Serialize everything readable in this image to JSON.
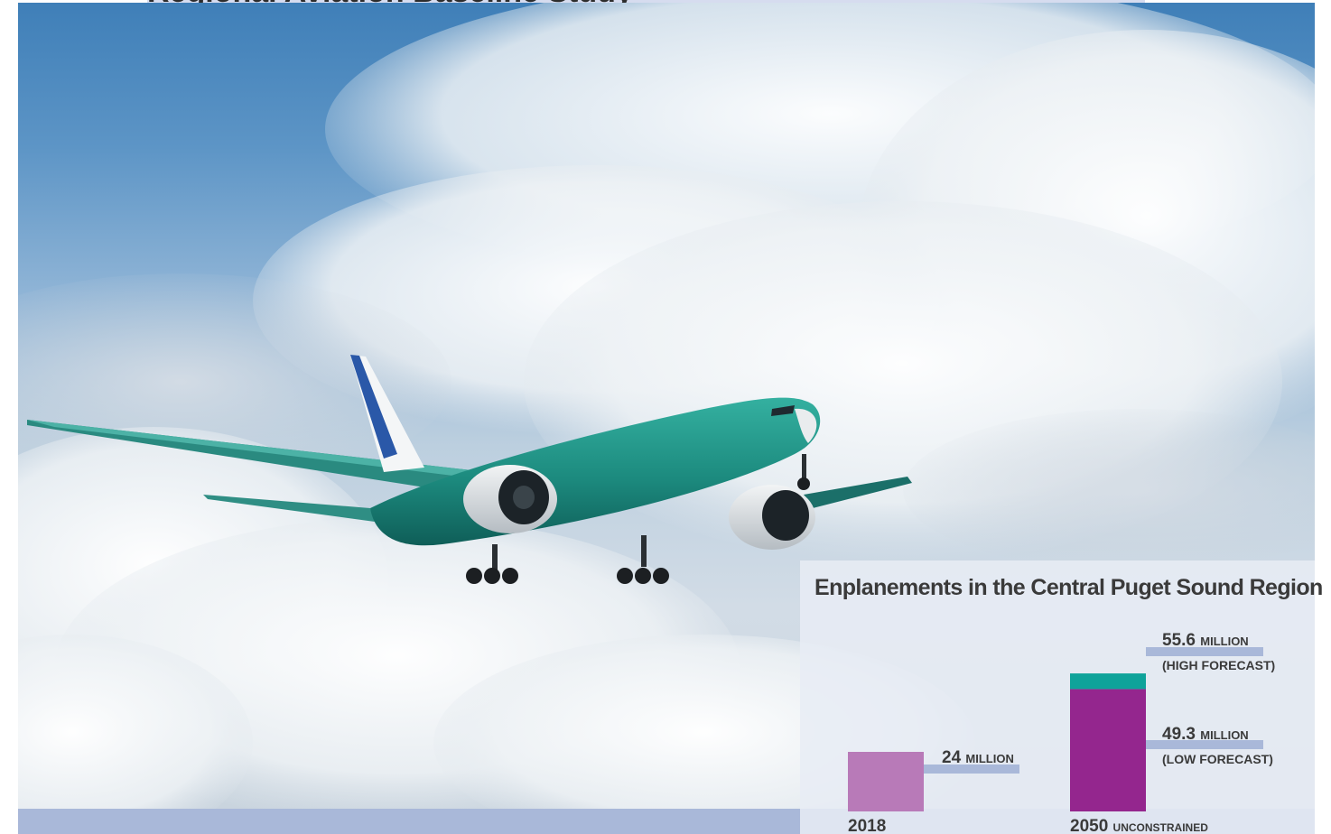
{
  "page_title": "Regional Aviation Baseline Study",
  "chart_data": {
    "type": "bar",
    "title": "Enplanements in the Central Puget Sound Region",
    "categories": [
      {
        "year": "2018",
        "suffix": ""
      },
      {
        "year": "2050",
        "suffix": "UNCONSTRAINED"
      }
    ],
    "bars": [
      {
        "category": "2018",
        "value": 24,
        "label_value": "24",
        "label_unit": "MILLION",
        "label_note": "",
        "color": "#b87ab8"
      },
      {
        "category": "2050",
        "value": 49.3,
        "label_value": "49.3",
        "label_unit": "MILLION",
        "label_note": "(LOW FORECAST)",
        "color": "#94268e"
      },
      {
        "category": "2050",
        "value": 55.6,
        "label_value": "55.6",
        "label_unit": "MILLION",
        "label_note": "(HIGH FORECAST)",
        "color": "#0fa39a",
        "stacked_on_previous": true
      }
    ],
    "units": "million enplanements",
    "ylim": [
      0,
      60
    ],
    "grid": false,
    "legend": "none"
  },
  "colors": {
    "title_bar": "#d6dcef",
    "bottom_band": "#a9b8d9",
    "leader_line": "#a9b8d9",
    "text": "#3a3a3a"
  }
}
